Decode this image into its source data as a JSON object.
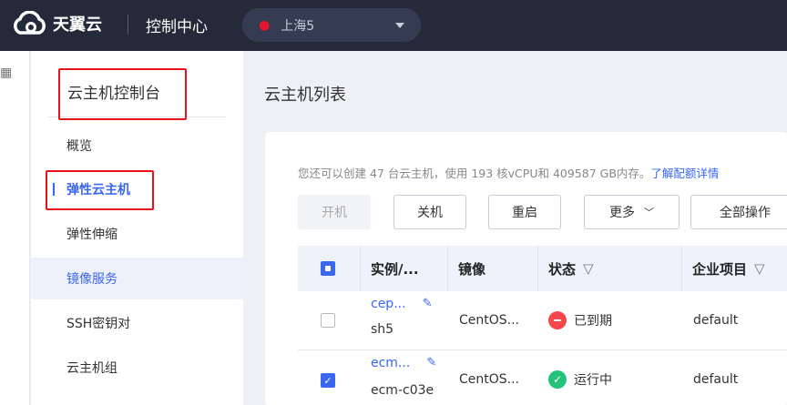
{
  "header": {
    "brand": "天翼云",
    "console": "控制中心",
    "region": "上海5"
  },
  "sidebar": {
    "title": "云主机控制台",
    "items": [
      {
        "label": "概览"
      },
      {
        "label": "弹性云主机"
      },
      {
        "label": "弹性伸缩"
      },
      {
        "label": "镜像服务"
      },
      {
        "label": "SSH密钥对"
      },
      {
        "label": "云主机组"
      }
    ]
  },
  "main": {
    "title": "云主机列表",
    "quota_text": "您还可以创建 47 台云主机，使用 193 核vCPU和 409587 GB内存。",
    "quota_link": "了解配额详情",
    "buttons": {
      "start": "开机",
      "stop": "关机",
      "restart": "重启",
      "more": "更多",
      "all_ops": "全部操作"
    },
    "columns": [
      "实例/...",
      "镜像",
      "状态",
      "企业项目"
    ],
    "rows": [
      {
        "name": "cep...",
        "sub": "sh5",
        "image": "CentOS...",
        "status": "已到期",
        "status_color": "#f5474c",
        "project": "default",
        "checked": false
      },
      {
        "name": "ecm...",
        "sub": "ecm-c03e",
        "image": "CentOS...",
        "status": "运行中",
        "status_color": "#25c27a",
        "project": "default",
        "checked": true
      }
    ]
  },
  "accent": "#3a66f0"
}
